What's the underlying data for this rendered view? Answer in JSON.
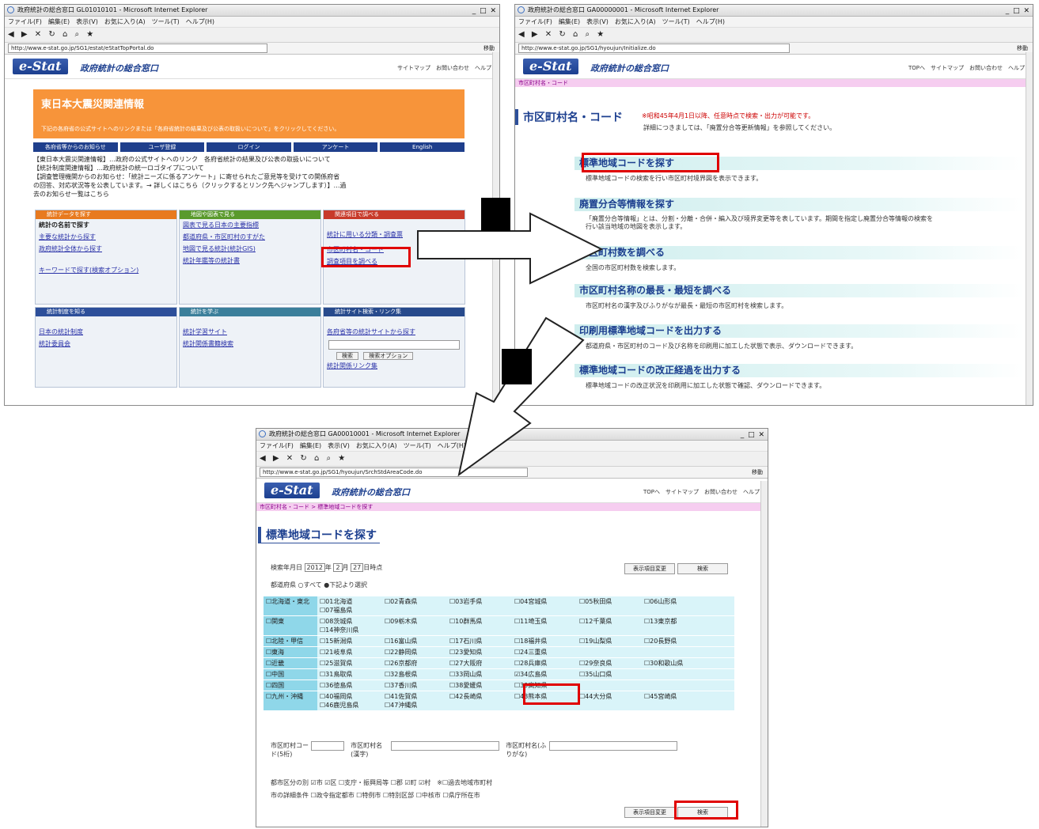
{
  "shared": {
    "menu": "ファイル(F)　編集(E)　表示(V)　お気に入り(A)　ツール(T)　ヘルプ(H)",
    "toolbar": [
      "戻る",
      "進む",
      "検索",
      "お気に入り"
    ],
    "go": "移動",
    "site_title": "政府統計の総合窓口",
    "logo": "e-Stat"
  },
  "win1": {
    "title": "政府統計の総合窓口 GL01010101 - Microsoft Internet Explorer",
    "url": "http://www.e-stat.go.jp/SG1/estat/eStatTopPortal.do",
    "toplinks": "サイトマップ　お問い合わせ　ヘルプ",
    "banner_title": "東日本大震災関連情報",
    "banner_sub": "下記の各府省の公式サイトへのリンクまたは「各府省統計の結果及び公表の取扱いについて」をクリックしてください。",
    "nav": [
      "各府省等からのお知らせ",
      "ユーザ登録",
      "ログイン",
      "アンケート",
      "English"
    ],
    "news": [
      "【東日本大震災関連情報】…政府の公式サイトへのリンク　各府省統計の結果及び公表の取扱いについて",
      "【統計制度関連情報】…政府統計の統一ロゴタイプについて",
      "【調査管理機関からのお知らせ：「統計ニーズに係るアンケート」に寄せられたご意見等を受けての関係府省",
      "の回答、対応状況等を公表しています。→ 詳しくはこちら（クリックするとリンク先へジャンプします）】…過",
      "去のお知らせ一覧はこちら"
    ],
    "panes": {
      "p1": {
        "head": "統計データを探す",
        "links": [
          "統計の名前で探す",
          "主要な統計から探す",
          "政府統計全体から探す",
          "キーワードで探す(検索オプション)"
        ]
      },
      "p2": {
        "head": "地図や図表で見る",
        "links": [
          "図表で見る日本の主要指標",
          "都道府県・市区町村のすがた",
          "地図で見る統計(統計GIS)",
          "統計年鑑等の統計書"
        ]
      },
      "p3": {
        "head": "関連項目で調べる",
        "links": [
          "統計に用いる分類・調査票",
          "市区町村名・コード",
          "調査項目を調べる"
        ]
      },
      "p4": {
        "head": "統計制度を知る",
        "links": [
          "日本の統計制度",
          "統計委員会"
        ]
      },
      "p5": {
        "head": "統計を学ぶ",
        "links": [
          "統計学習サイト",
          "統計関係書籍検索"
        ]
      },
      "p6": {
        "head": "統計サイト検索・リンク集",
        "links": [
          "各府省等の統計サイトから探す",
          "統計関係リンク集"
        ],
        "search": "検索",
        "option": "検索オプション"
      }
    }
  },
  "win2": {
    "title": "政府統計の総合窓口 GA00000001 - Microsoft Internet Explorer",
    "url": "http://www.e-stat.go.jp/SG1/hyoujun/Initialize.do",
    "toplinks": "TOPへ　サイトマップ　お問い合わせ　ヘルプ",
    "crumb": "市区町村名・コード",
    "heading": "市区町村名・コード",
    "notice": "※昭和45年4月1日以降、任意時点で検索・出力が可能です。",
    "notice2": "詳細につきましては、「廃置分合等更新情報」を参照してください。",
    "items": [
      {
        "title": "標準地域コードを探す",
        "desc": "標準地域コードの検索を行い市区町村境界図を表示できます。"
      },
      {
        "title": "廃置分合等情報を探す",
        "desc": "「廃置分合等情報」とは、分割・分離・合併・編入及び境界変更等を表しています。期間を指定し廃置分合等情報の検索を行い該当地域の地図を表示します。"
      },
      {
        "title": "市区町村数を調べる",
        "desc": "全国の市区町村数を検索します。"
      },
      {
        "title": "市区町村名称の最長・最短を調べる",
        "desc": "市区町村名の漢字及びふりがなが最長・最短の市区町村を検索します。"
      },
      {
        "title": "印刷用標準地域コードを出力する",
        "desc": "都道府県・市区町村のコード及び名称を印刷用に加工した状態で表示、ダウンロードできます。"
      },
      {
        "title": "標準地域コードの改正経過を出力する",
        "desc": "標準地域コードの改正状況を印刷用に加工した状態で確認、ダウンロードできます。"
      }
    ]
  },
  "win3": {
    "title": "政府統計の総合窓口 GA00010001 - Microsoft Internet Explorer",
    "url": "http://www.e-stat.go.jp/SG1/hyoujun/SrchStdAreaCode.do",
    "toplinks": "TOPへ　サイトマップ　お問い合わせ　ヘルプ",
    "crumb": "市区町村名・コード > 標準地域コードを探す",
    "heading": "標準地域コードを探す",
    "date_label": "検索年月日",
    "year": "2012",
    "year_suffix": "年",
    "month": "2",
    "month_suffix": "月",
    "day": "27",
    "day_suffix": "日時点",
    "clear_btn": "表示項目変更",
    "search_btn": "検索",
    "pref_label": "都道府県",
    "pref_all": "すべて",
    "pref_select": "下記より選択",
    "regions": [
      {
        "name": "北海道・東北",
        "prefs": [
          "01北海道",
          "02青森県",
          "03岩手県",
          "04宮城県",
          "05秋田県",
          "06山形県",
          "07福島県"
        ]
      },
      {
        "name": "関東",
        "prefs": [
          "08茨城県",
          "09栃木県",
          "10群馬県",
          "11埼玉県",
          "12千葉県",
          "13東京都",
          "14神奈川県"
        ]
      },
      {
        "name": "北陸・甲信",
        "prefs": [
          "15新潟県",
          "16富山県",
          "17石川県",
          "18福井県",
          "19山梨県",
          "20長野県"
        ]
      },
      {
        "name": "東海",
        "prefs": [
          "21岐阜県",
          "22静岡県",
          "23愛知県",
          "24三重県"
        ]
      },
      {
        "name": "近畿",
        "prefs": [
          "25滋賀県",
          "26京都府",
          "27大阪府",
          "28兵庫県",
          "29奈良県",
          "30和歌山県"
        ]
      },
      {
        "name": "中国",
        "prefs": [
          "31鳥取県",
          "32島根県",
          "33岡山県",
          "34広島県",
          "35山口県"
        ]
      },
      {
        "name": "四国",
        "prefs": [
          "36徳島県",
          "37香川県",
          "38愛媛県",
          "39高知県"
        ]
      },
      {
        "name": "九州・沖縄",
        "prefs": [
          "40福岡県",
          "41佐賀県",
          "42長崎県",
          "43熊本県",
          "44大分県",
          "45宮崎県",
          "46鹿児島県",
          "47沖縄県"
        ]
      }
    ],
    "code_label": "市区町村コード(5桁)",
    "kanji_label": "市区町村名(漢字)",
    "kana_label": "市区町村名(ふりがな)",
    "type_label": "都市区分の別",
    "types": "☑市 ☑区 ☐支庁・振興局等 ☐郡 ☑町 ☑村　※☐過去地域市町村",
    "detail_label": "市の詳細条件",
    "details": "☐政令指定都市 ☐特例市 ☐特別区部 ☐中核市 ☐県庁所在市",
    "clear_btn2": "表示項目変更",
    "search_btn2": "検索"
  },
  "colors": {
    "red": "#e00000",
    "navy": "#1c3f8f",
    "pink": "#f6cdf0",
    "cyan": "#8fd7e9"
  }
}
